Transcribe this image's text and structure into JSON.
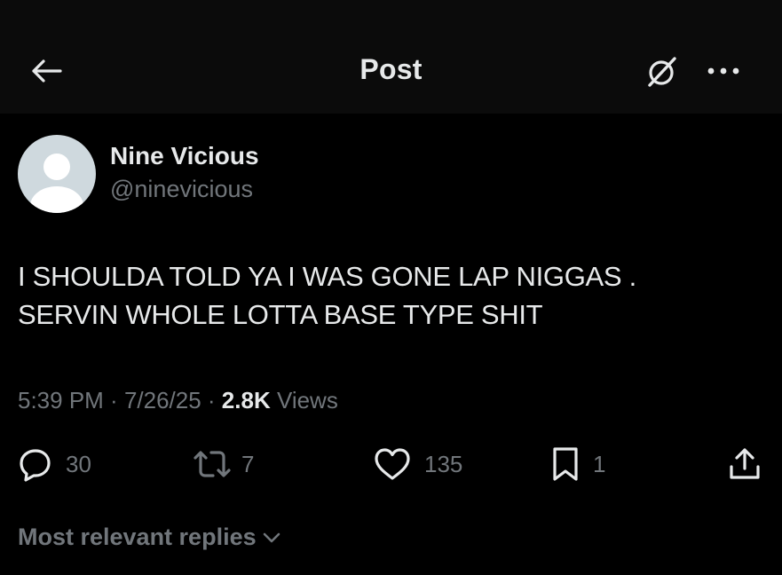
{
  "header": {
    "title": "Post",
    "back_icon": "arrow-left-icon",
    "grok_icon": "grok-icon",
    "more_icon": "more-dots-icon"
  },
  "author": {
    "display_name": "Nine Vicious",
    "handle": "@ninevicious",
    "avatar": "default-avatar-icon"
  },
  "tweet": {
    "lines": [
      "I SHOULDA TOLD YA I WAS GONE LAP NIGGAS .",
      "SERVIN WHOLE LOTTA BASE TYPE SHIT"
    ]
  },
  "meta": {
    "time": "5:39 PM",
    "sep1": " · ",
    "date": "7/26/25",
    "sep2": " · ",
    "views_count": "2.8K",
    "views_label": " Views"
  },
  "actions": {
    "replies": "30",
    "reposts": "7",
    "likes": "135",
    "bookmarks": "1"
  },
  "replies_sort": {
    "label": "Most relevant replies"
  },
  "colors": {
    "background": "#000000",
    "header_background": "#0b0b0b",
    "primary_text": "#e7e9ea",
    "secondary_text": "#71767b",
    "avatar_background": "#cfd9de"
  }
}
